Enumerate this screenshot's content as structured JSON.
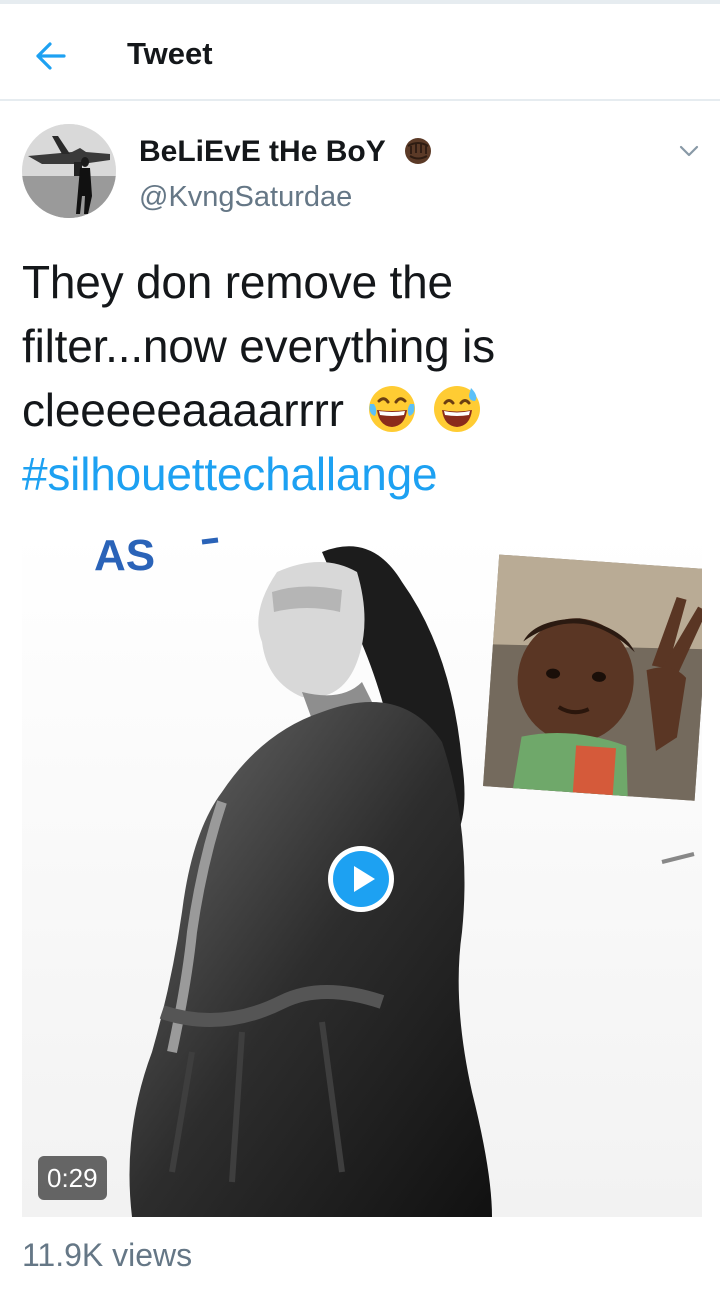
{
  "header": {
    "title": "Tweet",
    "back_icon": "arrow-left-icon"
  },
  "author": {
    "display_name": "BeLiEvE tHe BoY",
    "name_emoji": "raised-fist-emoji",
    "handle": "@KvngSaturdae"
  },
  "tweet": {
    "text_lines": [
      "They don remove the",
      "filter...now everything is",
      "cleeeeeaaaarrrr"
    ],
    "emojis": [
      "face-with-tears-of-joy-emoji",
      "grinning-face-with-sweat-emoji"
    ],
    "hashtag": "#silhouettechallange"
  },
  "media": {
    "overlay_text": "AS",
    "duration": "0:29",
    "play_icon": "play-icon"
  },
  "stats": {
    "views": "11.9K views"
  },
  "colors": {
    "accent": "#1da1f2",
    "secondary_text": "#657786",
    "primary_text": "#14171a",
    "divider": "#e6ecf0"
  }
}
